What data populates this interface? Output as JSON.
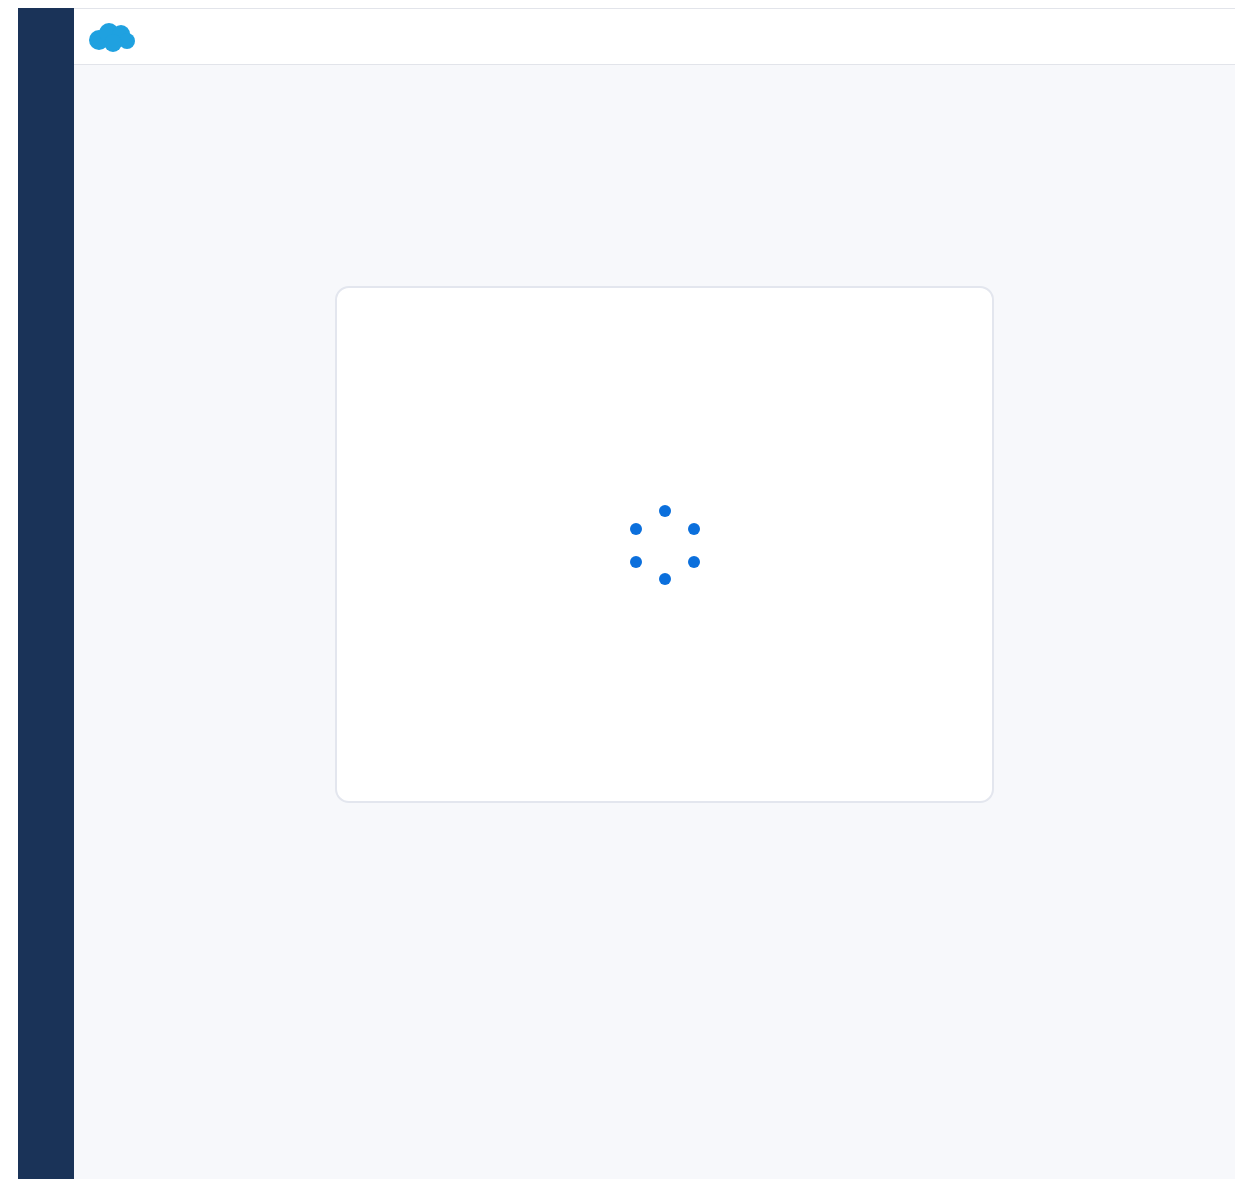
{
  "header": {
    "logo": {
      "kind": "cloud"
    }
  },
  "content": {
    "card": {
      "kind": "loading"
    }
  }
}
